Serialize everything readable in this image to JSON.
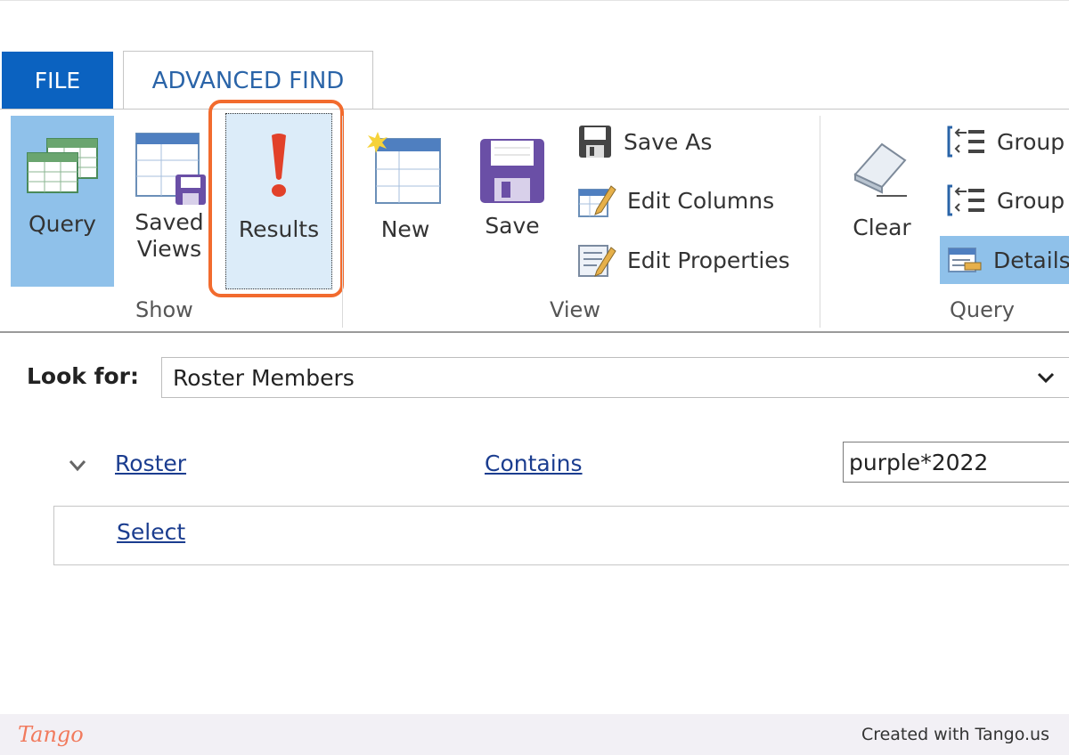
{
  "tabs": {
    "file": "FILE",
    "advanced_find": "ADVANCED FIND"
  },
  "ribbon": {
    "show": {
      "query": "Query",
      "saved_views_1": "Saved",
      "saved_views_2": "Views",
      "results": "Results",
      "group_label": "Show"
    },
    "view": {
      "new": "New",
      "save": "Save",
      "save_as": "Save As",
      "edit_columns": "Edit Columns",
      "edit_properties": "Edit Properties",
      "group_label": "View"
    },
    "query": {
      "clear": "Clear",
      "group1": "Group",
      "group2": "Group",
      "details": "Details",
      "group_label": "Query"
    }
  },
  "lookfor": {
    "label": "Look for:",
    "value": "Roster Members"
  },
  "condition": {
    "field": "Roster",
    "operator": "Contains",
    "value": "purple*2022"
  },
  "select_link": "Select",
  "footer": {
    "logo": "Tango",
    "credit": "Created with Tango.us"
  },
  "colors": {
    "file_tab": "#0b62c0",
    "selected_button": "#8fc1ea",
    "highlight": "#f26b2e",
    "link": "#1b3d8f"
  },
  "icons": [
    "query-table-icon",
    "saved-views-icon",
    "results-exclamation-icon",
    "new-view-icon",
    "save-disk-icon",
    "save-as-icon",
    "edit-columns-icon",
    "edit-properties-icon",
    "clear-eraser-icon",
    "group-and-icon",
    "group-or-icon",
    "details-icon",
    "chevron-down-icon"
  ]
}
